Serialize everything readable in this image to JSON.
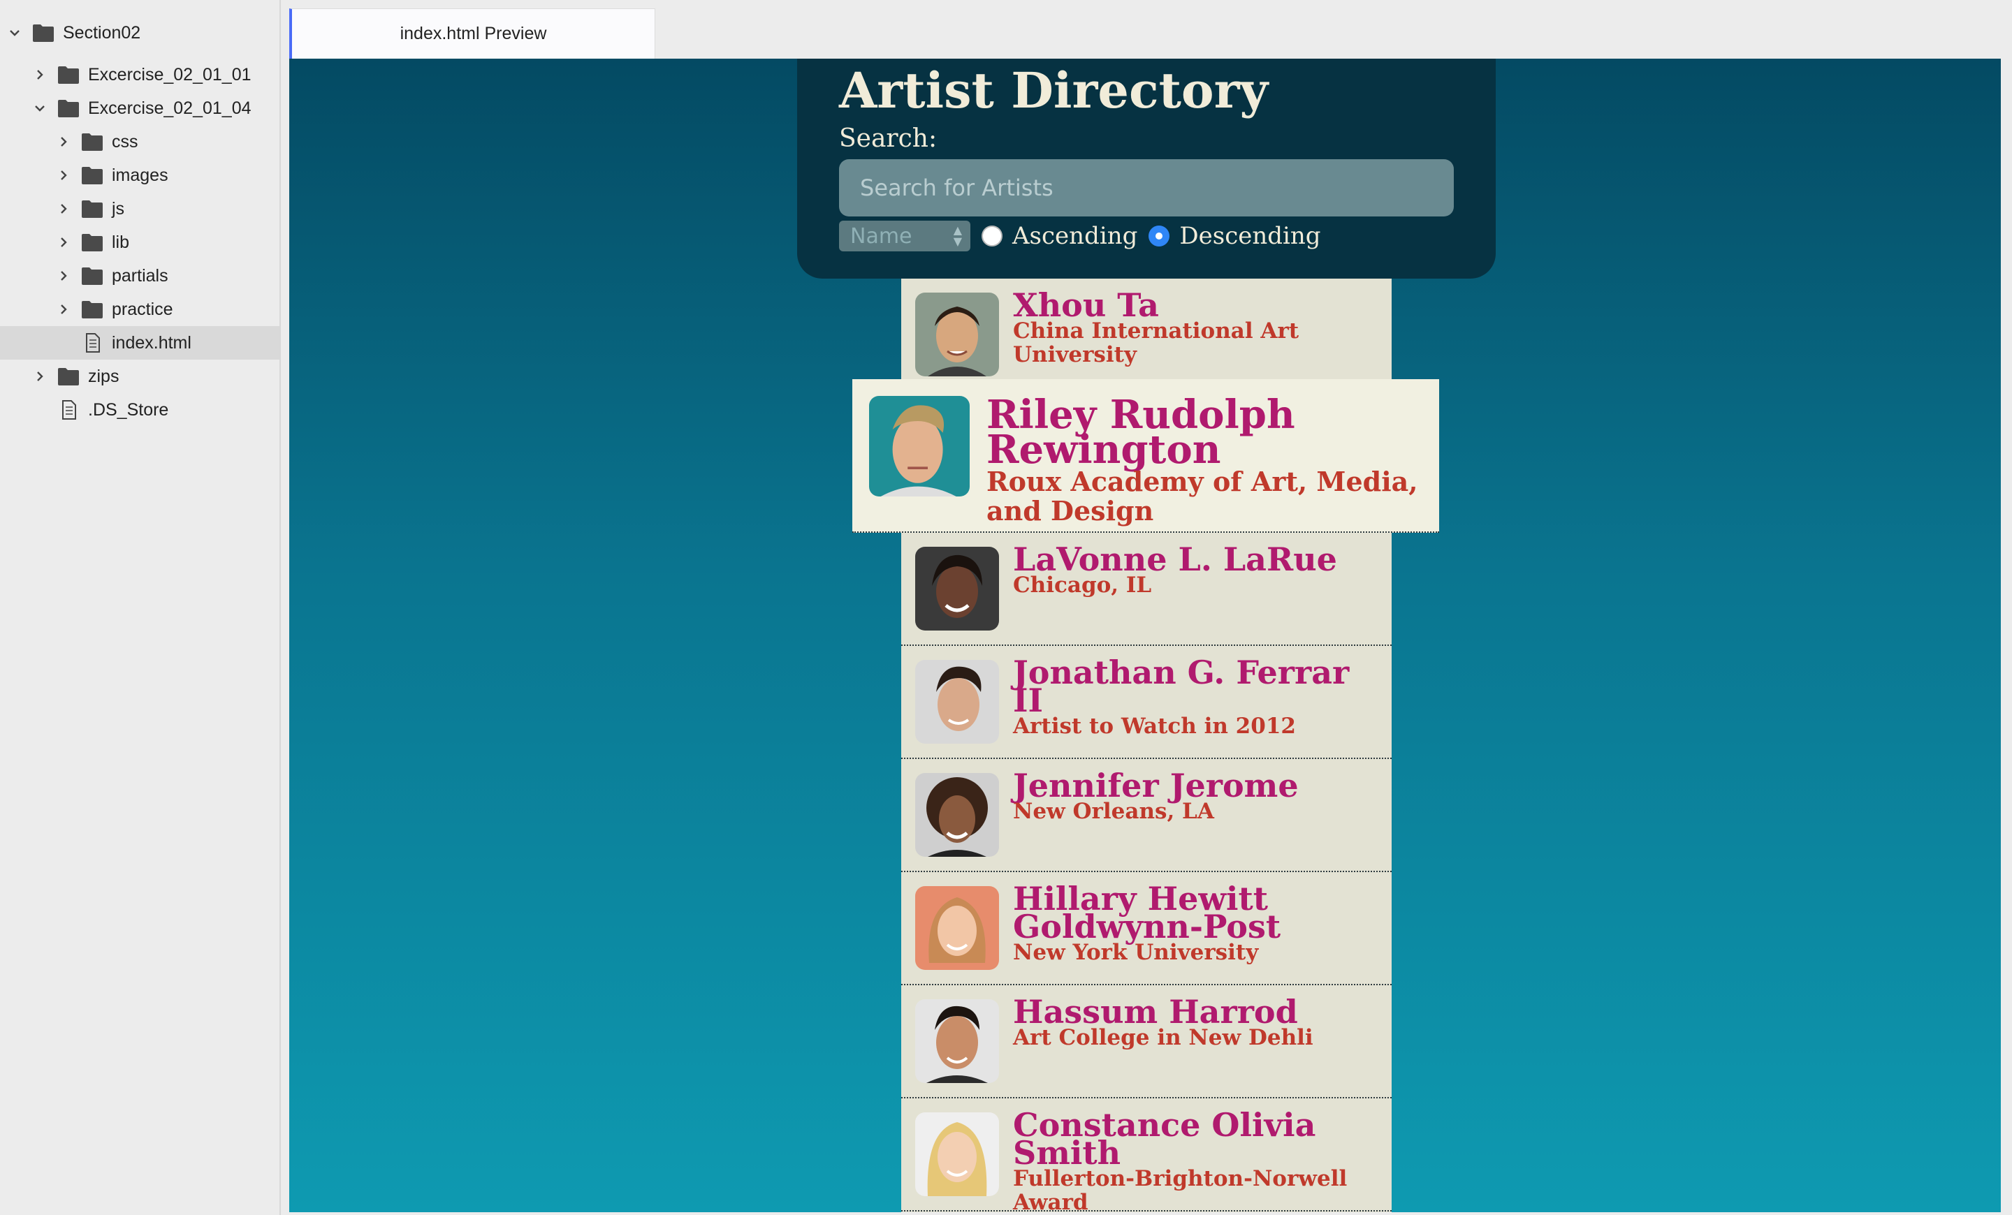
{
  "sidebar": {
    "tree": [
      {
        "label": "Section02",
        "type": "folder",
        "expanded": true,
        "depth": 0
      },
      {
        "label": "Excercise_02_01_01",
        "type": "folder",
        "expanded": false,
        "depth": 1
      },
      {
        "label": "Excercise_02_01_04",
        "type": "folder",
        "expanded": true,
        "depth": 1
      },
      {
        "label": "css",
        "type": "folder",
        "expanded": false,
        "depth": 2
      },
      {
        "label": "images",
        "type": "folder",
        "expanded": false,
        "depth": 2
      },
      {
        "label": "js",
        "type": "folder",
        "expanded": false,
        "depth": 2
      },
      {
        "label": "lib",
        "type": "folder",
        "expanded": false,
        "depth": 2
      },
      {
        "label": "partials",
        "type": "folder",
        "expanded": false,
        "depth": 2
      },
      {
        "label": "practice",
        "type": "folder",
        "expanded": false,
        "depth": 2
      },
      {
        "label": "index.html",
        "type": "file",
        "selected": true,
        "depth": 2
      },
      {
        "label": "zips",
        "type": "folder",
        "expanded": false,
        "depth": 1
      },
      {
        "label": ".DS_Store",
        "type": "file",
        "depth": 1
      }
    ]
  },
  "tab": {
    "label": "index.html Preview"
  },
  "app": {
    "title": "Artist Directory",
    "search_label": "Search:",
    "search_placeholder": "Search for Artists",
    "sort_select": "Name",
    "ascending_label": "Ascending",
    "descending_label": "Descending",
    "sort_order": "descending"
  },
  "artists": [
    {
      "name": "Xhou Ta",
      "reknown": "China International Art University"
    },
    {
      "name": "Riley Rudolph Rewington",
      "reknown": "Roux Academy of Art, Media, and Design",
      "featured": true
    },
    {
      "name": "LaVonne L. LaRue",
      "reknown": "Chicago, IL"
    },
    {
      "name": "Jonathan G. Ferrar II",
      "reknown": "Artist to Watch in 2012"
    },
    {
      "name": "Jennifer Jerome",
      "reknown": "New Orleans, LA"
    },
    {
      "name": "Hillary Hewitt Goldwynn-Post",
      "reknown": "New York University"
    },
    {
      "name": "Hassum Harrod",
      "reknown": "Art College in New Dehli"
    },
    {
      "name": "Constance Olivia Smith",
      "reknown": "Fullerton-Brighton-Norwell Award"
    }
  ],
  "colors": {
    "accent": "#4a6cf7",
    "header_bg": "#063242",
    "name": "#b01a6e",
    "reknown": "#c0392b",
    "list_bg": "#e3e2d3"
  }
}
